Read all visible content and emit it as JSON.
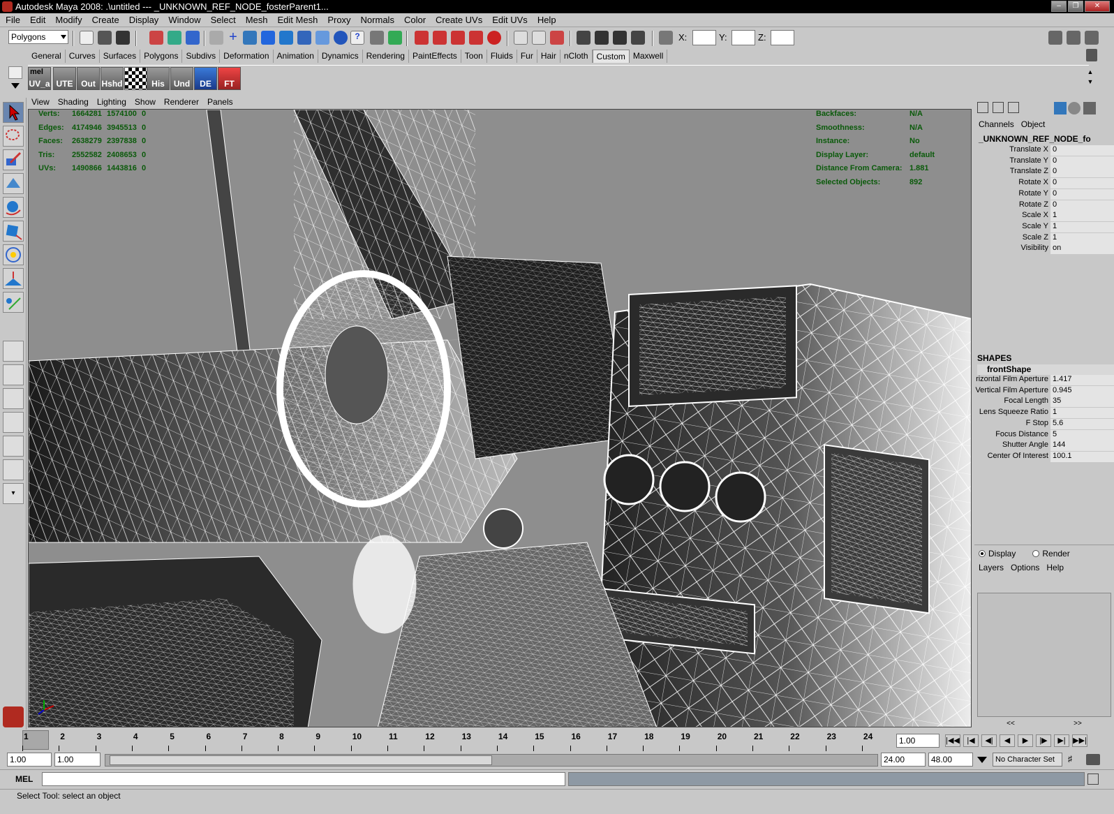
{
  "window": {
    "title": "Autodesk Maya 2008: .\\untitled   ---   _UNKNOWN_REF_NODE_fosterParent1..."
  },
  "menus": [
    "File",
    "Edit",
    "Modify",
    "Create",
    "Display",
    "Window",
    "Select",
    "Mesh",
    "Edit Mesh",
    "Proxy",
    "Normals",
    "Color",
    "Create UVs",
    "Edit UVs",
    "Help"
  ],
  "status_line": {
    "mode": "Polygons",
    "x_label": "X:",
    "y_label": "Y:",
    "z_label": "Z:"
  },
  "shelf_tabs": [
    "General",
    "Curves",
    "Surfaces",
    "Polygons",
    "Subdivs",
    "Deformation",
    "Animation",
    "Dynamics",
    "Rendering",
    "PaintEffects",
    "Toon",
    "Fluids",
    "Fur",
    "Hair",
    "nCloth",
    "Custom",
    "Maxwell"
  ],
  "shelf_tabs_active": "Custom",
  "shelf_buttons": [
    {
      "label": "UV_a",
      "top": "mel"
    },
    {
      "label": "UTE"
    },
    {
      "label": "Out"
    },
    {
      "label": "Hshd"
    },
    {
      "label": ""
    },
    {
      "label": "His"
    },
    {
      "label": "Und"
    },
    {
      "label": "DE"
    },
    {
      "label": "FT"
    }
  ],
  "panel_menu": [
    "View",
    "Shading",
    "Lighting",
    "Show",
    "Renderer",
    "Panels"
  ],
  "hud_left": [
    {
      "label": "Verts:",
      "v1": "1664281",
      "v2": "1574100",
      "v3": "0"
    },
    {
      "label": "Edges:",
      "v1": "4174946",
      "v2": "3945513",
      "v3": "0"
    },
    {
      "label": "Faces:",
      "v1": "2638279",
      "v2": "2397838",
      "v3": "0"
    },
    {
      "label": "Tris:",
      "v1": "2552582",
      "v2": "2408653",
      "v3": "0"
    },
    {
      "label": "UVs:",
      "v1": "1490866",
      "v2": "1443816",
      "v3": "0"
    }
  ],
  "hud_right": [
    {
      "label": "Backfaces:",
      "value": "N/A"
    },
    {
      "label": "Smoothness:",
      "value": "N/A"
    },
    {
      "label": "Instance:",
      "value": "No"
    },
    {
      "label": "Display Layer:",
      "value": "default"
    },
    {
      "label": "Distance From Camera:",
      "value": "1.881"
    },
    {
      "label": "Selected Objects:",
      "value": "892"
    }
  ],
  "channel_box": {
    "tabs": [
      "Channels",
      "Object"
    ],
    "node_name": "_UNKNOWN_REF_NODE_fo",
    "attributes": [
      {
        "name": "Translate X",
        "value": "0"
      },
      {
        "name": "Translate Y",
        "value": "0"
      },
      {
        "name": "Translate Z",
        "value": "0"
      },
      {
        "name": "Rotate X",
        "value": "0"
      },
      {
        "name": "Rotate Y",
        "value": "0"
      },
      {
        "name": "Rotate Z",
        "value": "0"
      },
      {
        "name": "Scale X",
        "value": "1"
      },
      {
        "name": "Scale Y",
        "value": "1"
      },
      {
        "name": "Scale Z",
        "value": "1"
      },
      {
        "name": "Visibility",
        "value": "on"
      }
    ],
    "shapes_header": "SHAPES",
    "shape_name": "frontShape",
    "shape_attributes": [
      {
        "name": "rizontal Film Aperture",
        "value": "1.417"
      },
      {
        "name": "Vertical Film Aperture",
        "value": "0.945"
      },
      {
        "name": "Focal Length",
        "value": "35"
      },
      {
        "name": "Lens Squeeze Ratio",
        "value": "1"
      },
      {
        "name": "F Stop",
        "value": "5.6"
      },
      {
        "name": "Focus Distance",
        "value": "5"
      },
      {
        "name": "Shutter Angle",
        "value": "144"
      },
      {
        "name": "Center Of Interest",
        "value": "100.1"
      }
    ]
  },
  "layer_editor": {
    "display_label": "Display",
    "render_label": "Render",
    "menu": [
      "Layers",
      "Options",
      "Help"
    ],
    "scroll_left": "<<",
    "scroll_right": ">>"
  },
  "time_slider": {
    "frames": [
      "1",
      "2",
      "3",
      "4",
      "5",
      "6",
      "7",
      "8",
      "9",
      "10",
      "11",
      "12",
      "13",
      "14",
      "15",
      "16",
      "17",
      "18",
      "19",
      "20",
      "21",
      "22",
      "23",
      "24"
    ],
    "current_frame": "1.00",
    "current_value": 1
  },
  "range_slider": {
    "start_time": "1.00",
    "playback_start": "1.00",
    "playback_end": "24.00",
    "end_time": "48.00",
    "character_set": "No Character Set"
  },
  "command_line": {
    "label": "MEL"
  },
  "help_line": {
    "text": "Select Tool: select an object"
  },
  "colors": {
    "hud_text": "#0a5a0a",
    "viewport_bg": "#8e8e8e",
    "ui_bg": "#c8c8c8"
  }
}
